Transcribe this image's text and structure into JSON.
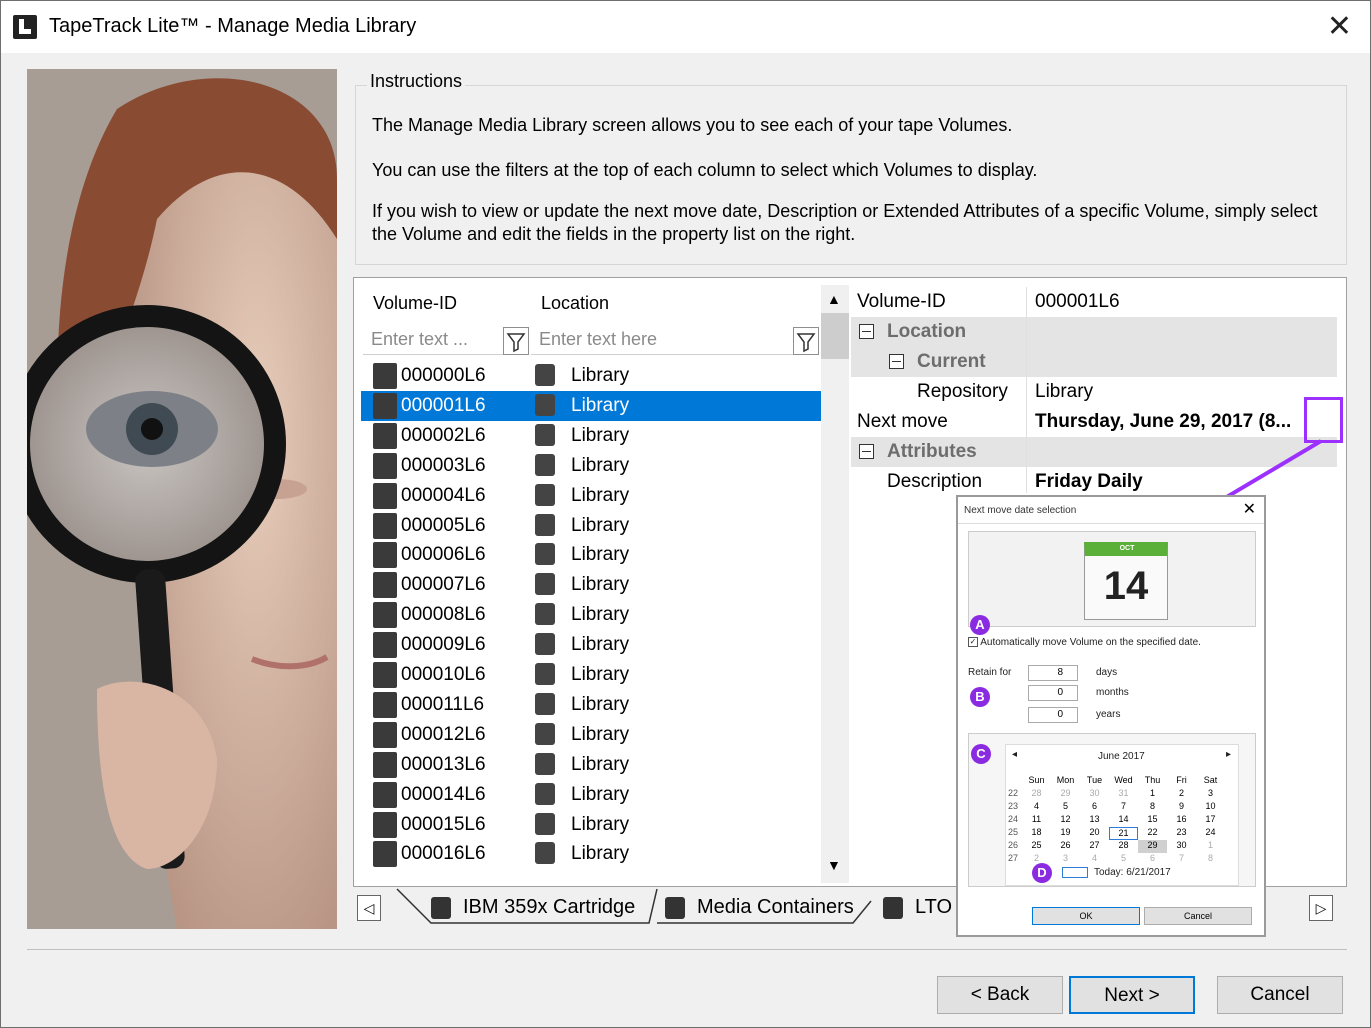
{
  "window": {
    "title": "TapeTrack Lite™ - Manage Media Library",
    "close_glyph": "✕"
  },
  "instructions": {
    "label": "Instructions",
    "p1": "The Manage Media Library screen allows you to see each of your tape Volumes.",
    "p2": "You can use the filters at the top of each column to select which Volumes to display.",
    "p3": "If you wish to view or update the next move date, Description or Extended Attributes of a specific Volume, simply select the Volume and edit the fields in the property list on the right."
  },
  "grid": {
    "col_volume": "Volume-ID",
    "col_location": "Location",
    "filter_volume_placeholder": "Enter text ...",
    "filter_location_placeholder": "Enter text here",
    "rows": [
      {
        "volume": "000000L6",
        "location": "Library"
      },
      {
        "volume": "000001L6",
        "location": "Library"
      },
      {
        "volume": "000002L6",
        "location": "Library"
      },
      {
        "volume": "000003L6",
        "location": "Library"
      },
      {
        "volume": "000004L6",
        "location": "Library"
      },
      {
        "volume": "000005L6",
        "location": "Library"
      },
      {
        "volume": "000006L6",
        "location": "Library"
      },
      {
        "volume": "000007L6",
        "location": "Library"
      },
      {
        "volume": "000008L6",
        "location": "Library"
      },
      {
        "volume": "000009L6",
        "location": "Library"
      },
      {
        "volume": "000010L6",
        "location": "Library"
      },
      {
        "volume": "000011L6",
        "location": "Library"
      },
      {
        "volume": "000012L6",
        "location": "Library"
      },
      {
        "volume": "000013L6",
        "location": "Library"
      },
      {
        "volume": "000014L6",
        "location": "Library"
      },
      {
        "volume": "000015L6",
        "location": "Library"
      },
      {
        "volume": "000016L6",
        "location": "Library"
      }
    ],
    "selected_index": 1
  },
  "properties": {
    "volume_id_key": "Volume-ID",
    "volume_id_value": "000001L6",
    "location_cat": "Location",
    "current_cat": "Current",
    "repository_key": "Repository",
    "repository_value": "Library",
    "next_move_key": "Next move",
    "next_move_value": "Thursday, June 29, 2017 (8...",
    "attributes_cat": "Attributes",
    "description_key": "Description",
    "description_value": "Friday Daily"
  },
  "tabs": {
    "tab1": "IBM 359x Cartridge",
    "tab2": "Media Containers",
    "tab3": "LTO"
  },
  "dialog": {
    "title": "Next move date selection",
    "cal_month_abbr": "OCT",
    "cal_day": "14",
    "badge_a": "A",
    "badge_b": "B",
    "badge_c": "C",
    "badge_d": "D",
    "auto_move_label": "Automatically move Volume on the specified date.",
    "retain_for": "Retain for",
    "days_value": "8",
    "days_label": "days",
    "months_value": "0",
    "months_label": "months",
    "years_value": "0",
    "years_label": "years",
    "month_title": "June 2017",
    "weekdays": [
      "Sun",
      "Mon",
      "Tue",
      "Wed",
      "Thu",
      "Fri",
      "Sat"
    ],
    "weeks": [
      {
        "wk": "22",
        "days": [
          "28",
          "29",
          "30",
          "31",
          "1",
          "2",
          "3"
        ]
      },
      {
        "wk": "23",
        "days": [
          "4",
          "5",
          "6",
          "7",
          "8",
          "9",
          "10"
        ]
      },
      {
        "wk": "24",
        "days": [
          "11",
          "12",
          "13",
          "14",
          "15",
          "16",
          "17"
        ]
      },
      {
        "wk": "25",
        "days": [
          "18",
          "19",
          "20",
          "21",
          "22",
          "23",
          "24"
        ]
      },
      {
        "wk": "26",
        "days": [
          "25",
          "26",
          "27",
          "28",
          "29",
          "30",
          "1"
        ]
      },
      {
        "wk": "27",
        "days": [
          "2",
          "3",
          "4",
          "5",
          "6",
          "7",
          "8"
        ]
      }
    ],
    "today_label": "Today: 6/21/2017",
    "ok": "OK",
    "cancel": "Cancel"
  },
  "buttons": {
    "back": "< Back",
    "next": "Next >",
    "cancel": "Cancel"
  },
  "colors": {
    "selection": "#0078d7",
    "highlight": "#9b30ff"
  }
}
